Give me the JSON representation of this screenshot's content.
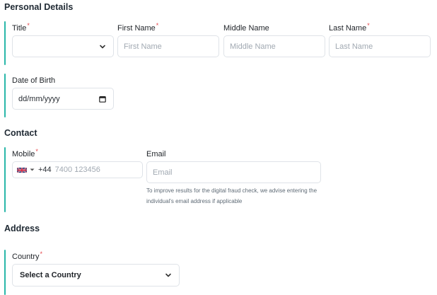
{
  "sections": {
    "personal_title": "Personal Details",
    "contact_title": "Contact",
    "address_title": "Address"
  },
  "personal": {
    "title_label": "Title",
    "first_name_label": "First Name",
    "first_name_placeholder": "First Name",
    "middle_name_label": "Middle Name",
    "middle_name_placeholder": "Middle Name",
    "last_name_label": "Last Name",
    "last_name_placeholder": "Last Name",
    "dob_label": "Date of Birth",
    "dob_placeholder": "dd/mm/yyyy"
  },
  "contact": {
    "mobile_label": "Mobile",
    "dial_code": "+44",
    "mobile_placeholder": "7400 123456",
    "email_label": "Email",
    "email_placeholder": "Email",
    "email_help": "To improve results for the digital fraud check, we advise entering the individual's email address if applicable"
  },
  "address": {
    "country_label": "Country",
    "country_value": "Select a Country"
  },
  "required_mark": "*",
  "colors": {
    "accent": "#2ab7a9",
    "required": "#e5484d",
    "border": "#dfe3e8"
  }
}
